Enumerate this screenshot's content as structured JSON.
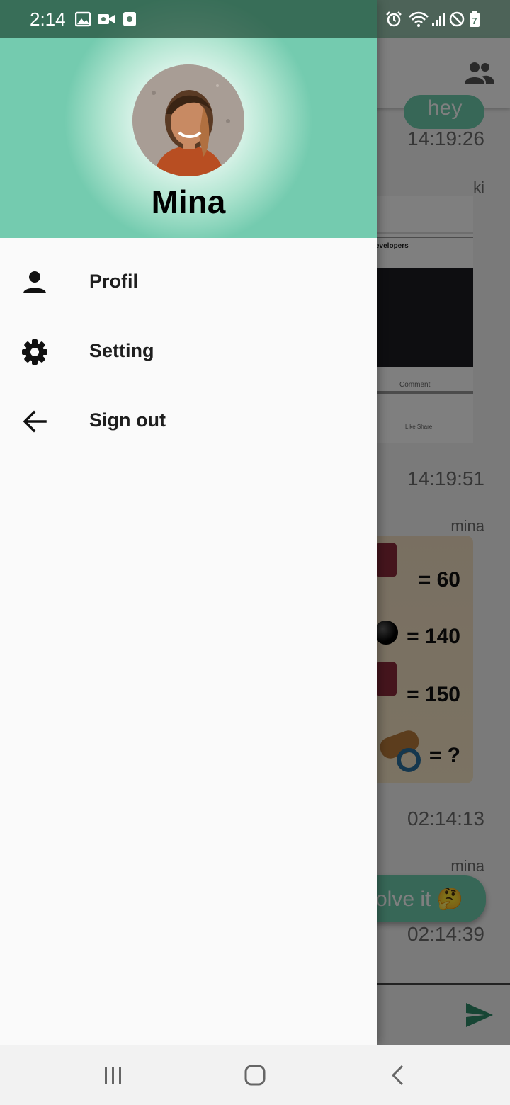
{
  "status_bar": {
    "time": "2:14",
    "left_icons": [
      "image-icon",
      "video-camera-icon",
      "screen-record-icon"
    ],
    "right_icons": [
      "alarm-icon",
      "wifi-icon",
      "signal-icon",
      "do-not-disturb-icon",
      "battery-icon"
    ],
    "battery_level": "7"
  },
  "drawer": {
    "user_name": "Mina",
    "menu": [
      {
        "label": "Profil",
        "icon": "person-icon"
      },
      {
        "label": "Setting",
        "icon": "gear-icon"
      },
      {
        "label": "Sign out",
        "icon": "arrow-back-icon"
      }
    ]
  },
  "chat": {
    "bubble_top_text": "hey",
    "timestamps": [
      "14:19:26",
      "14:19:51",
      "02:14:13",
      "02:14:39"
    ],
    "senders": [
      "ki",
      "mina",
      "mina"
    ],
    "screenshot_texts": [
      "evelopers",
      "Comment",
      "Like Share"
    ],
    "puzzle_rows": [
      "= 60",
      "= 140",
      "= 150",
      "= ?"
    ],
    "solve_text": "olve it 🤔"
  },
  "colors": {
    "accent": "#74cbaf",
    "drawer_bg": "#fafafa"
  }
}
